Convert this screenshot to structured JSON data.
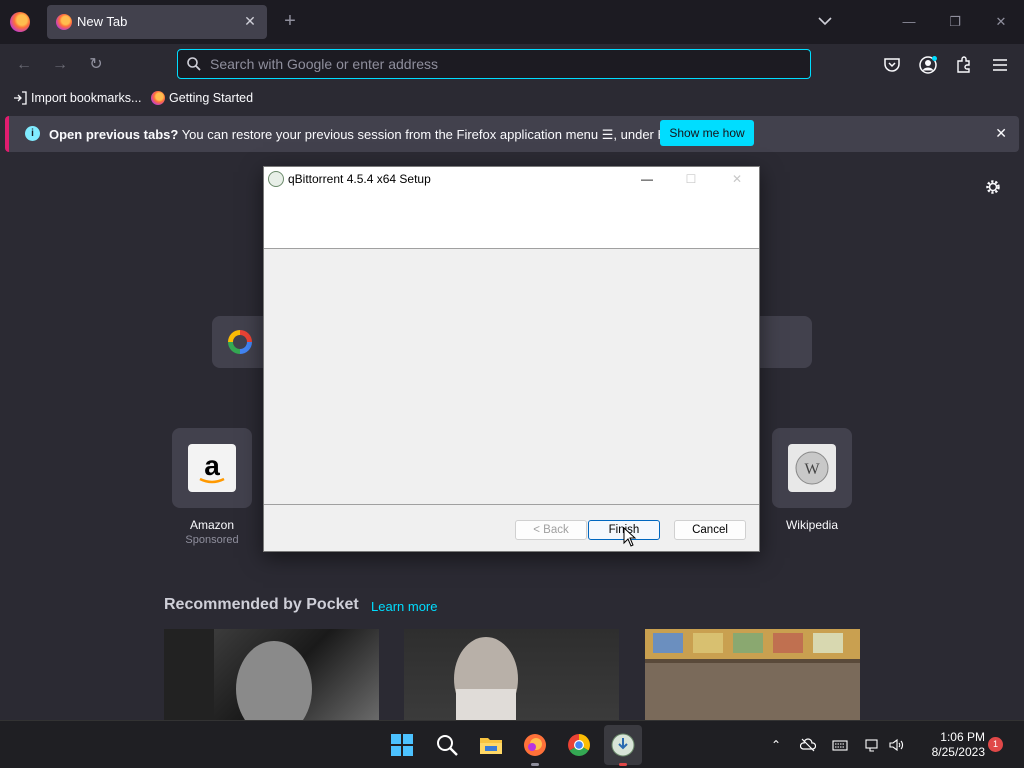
{
  "browser": {
    "tab": {
      "title": "New Tab"
    },
    "urlbar": {
      "placeholder": "Search with Google or enter address"
    },
    "bookmarks": [
      {
        "label": "Import bookmarks..."
      },
      {
        "label": "Getting Started"
      }
    ],
    "notification": {
      "bold": "Open previous tabs?",
      "text": " You can restore your previous session from the Firefox application menu ☰, under History.",
      "button": "Show me how",
      "accent_color": "#00ddff"
    }
  },
  "newtab": {
    "shortcuts": [
      {
        "label": "Amazon",
        "sub": "Sponsored"
      },
      {
        "label": "Wikipedia",
        "sub": ""
      }
    ],
    "pocket": {
      "title": "Recommended by Pocket",
      "link": "Learn more"
    }
  },
  "dialog": {
    "title": "qBittorrent 4.5.4 x64 Setup",
    "buttons": {
      "back": "< Back",
      "finish": "Finish",
      "cancel": "Cancel"
    }
  },
  "taskbar": {
    "time": "1:06 PM",
    "date": "8/25/2023",
    "notification_count": "1"
  }
}
